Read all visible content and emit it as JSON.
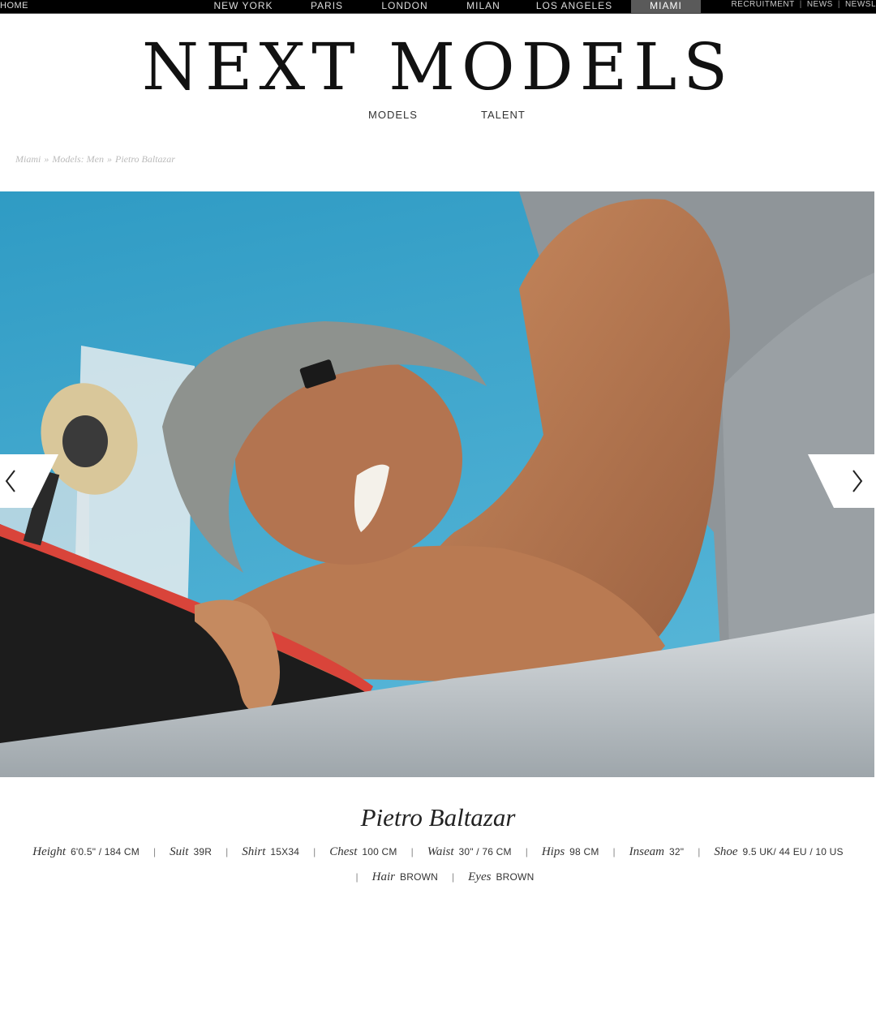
{
  "top_nav": {
    "home": "HOME",
    "cities": [
      "NEW YORK",
      "PARIS",
      "LONDON",
      "MILAN",
      "LOS ANGELES",
      "MIAMI"
    ],
    "active_city": "MIAMI",
    "right_links": [
      "RECRUITMENT",
      "NEWS",
      "NEWSL"
    ]
  },
  "logo": "NEXT MODELS",
  "main_nav": [
    "MODELS",
    "TALENT"
  ],
  "breadcrumb": [
    "Miami",
    "Models: Men",
    "Pietro Baltazar"
  ],
  "breadcrumb_sep": "»",
  "model": {
    "name": "Pietro Baltazar",
    "stats": [
      {
        "label": "Height",
        "value": "6'0.5\" / 184 CM"
      },
      {
        "label": "Suit",
        "value": "39R"
      },
      {
        "label": "Shirt",
        "value": "15X34"
      },
      {
        "label": "Chest",
        "value": "100 CM"
      },
      {
        "label": "Waist",
        "value": "30\" / 76 CM"
      },
      {
        "label": "Hips",
        "value": "98 CM"
      },
      {
        "label": "Inseam",
        "value": "32\""
      },
      {
        "label": "Shoe",
        "value": "9.5 UK/ 44 EU / 10 US"
      },
      {
        "label": "Hair",
        "value": "BROWN"
      },
      {
        "label": "Eyes",
        "value": "BROWN"
      }
    ]
  },
  "colors": {
    "topbar_bg": "#000000",
    "active_city_bg": "#5a5a5a",
    "sky": "#3aa6cc"
  },
  "icons": {
    "prev": "chevron-left-icon",
    "next": "chevron-right-icon"
  }
}
